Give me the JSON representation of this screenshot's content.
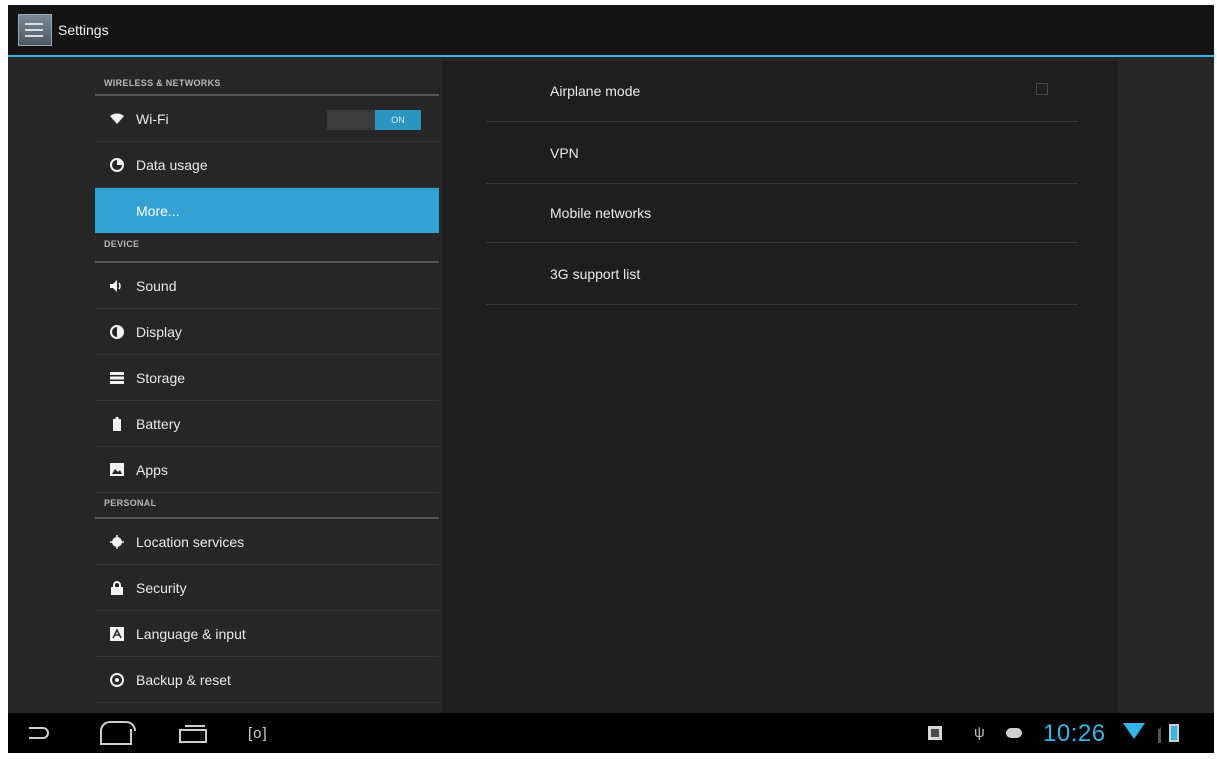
{
  "app": {
    "title": "Settings",
    "icon": "settings-app-icon"
  },
  "left": {
    "sections": [
      {
        "header": "WIRELESS & NETWORKS",
        "items": [
          {
            "label": "Wi-Fi",
            "icon": "wifi-icon",
            "toggle": "ON"
          },
          {
            "label": "Data usage",
            "icon": "data-usage-icon"
          },
          {
            "label": "More...",
            "selected": true
          }
        ]
      },
      {
        "header": "DEVICE",
        "items": [
          {
            "label": "Sound",
            "icon": "sound-icon"
          },
          {
            "label": "Display",
            "icon": "display-icon"
          },
          {
            "label": "Storage",
            "icon": "storage-icon"
          },
          {
            "label": "Battery",
            "icon": "battery-icon"
          },
          {
            "label": "Apps",
            "icon": "apps-icon"
          }
        ]
      },
      {
        "header": "PERSONAL",
        "items": [
          {
            "label": "Location services",
            "icon": "location-icon"
          },
          {
            "label": "Security",
            "icon": "lock-icon"
          },
          {
            "label": "Language & input",
            "icon": "language-icon"
          },
          {
            "label": "Backup & reset",
            "icon": "backup-icon"
          }
        ]
      }
    ]
  },
  "right": {
    "items": [
      {
        "label": "Airplane mode",
        "checkbox": false
      },
      {
        "label": "VPN"
      },
      {
        "label": "Mobile networks"
      },
      {
        "label": "3G support list"
      }
    ]
  },
  "statusbar": {
    "time": "10:26"
  },
  "colors": {
    "accent": "#33b5e5",
    "selected": "#33a2d2"
  }
}
